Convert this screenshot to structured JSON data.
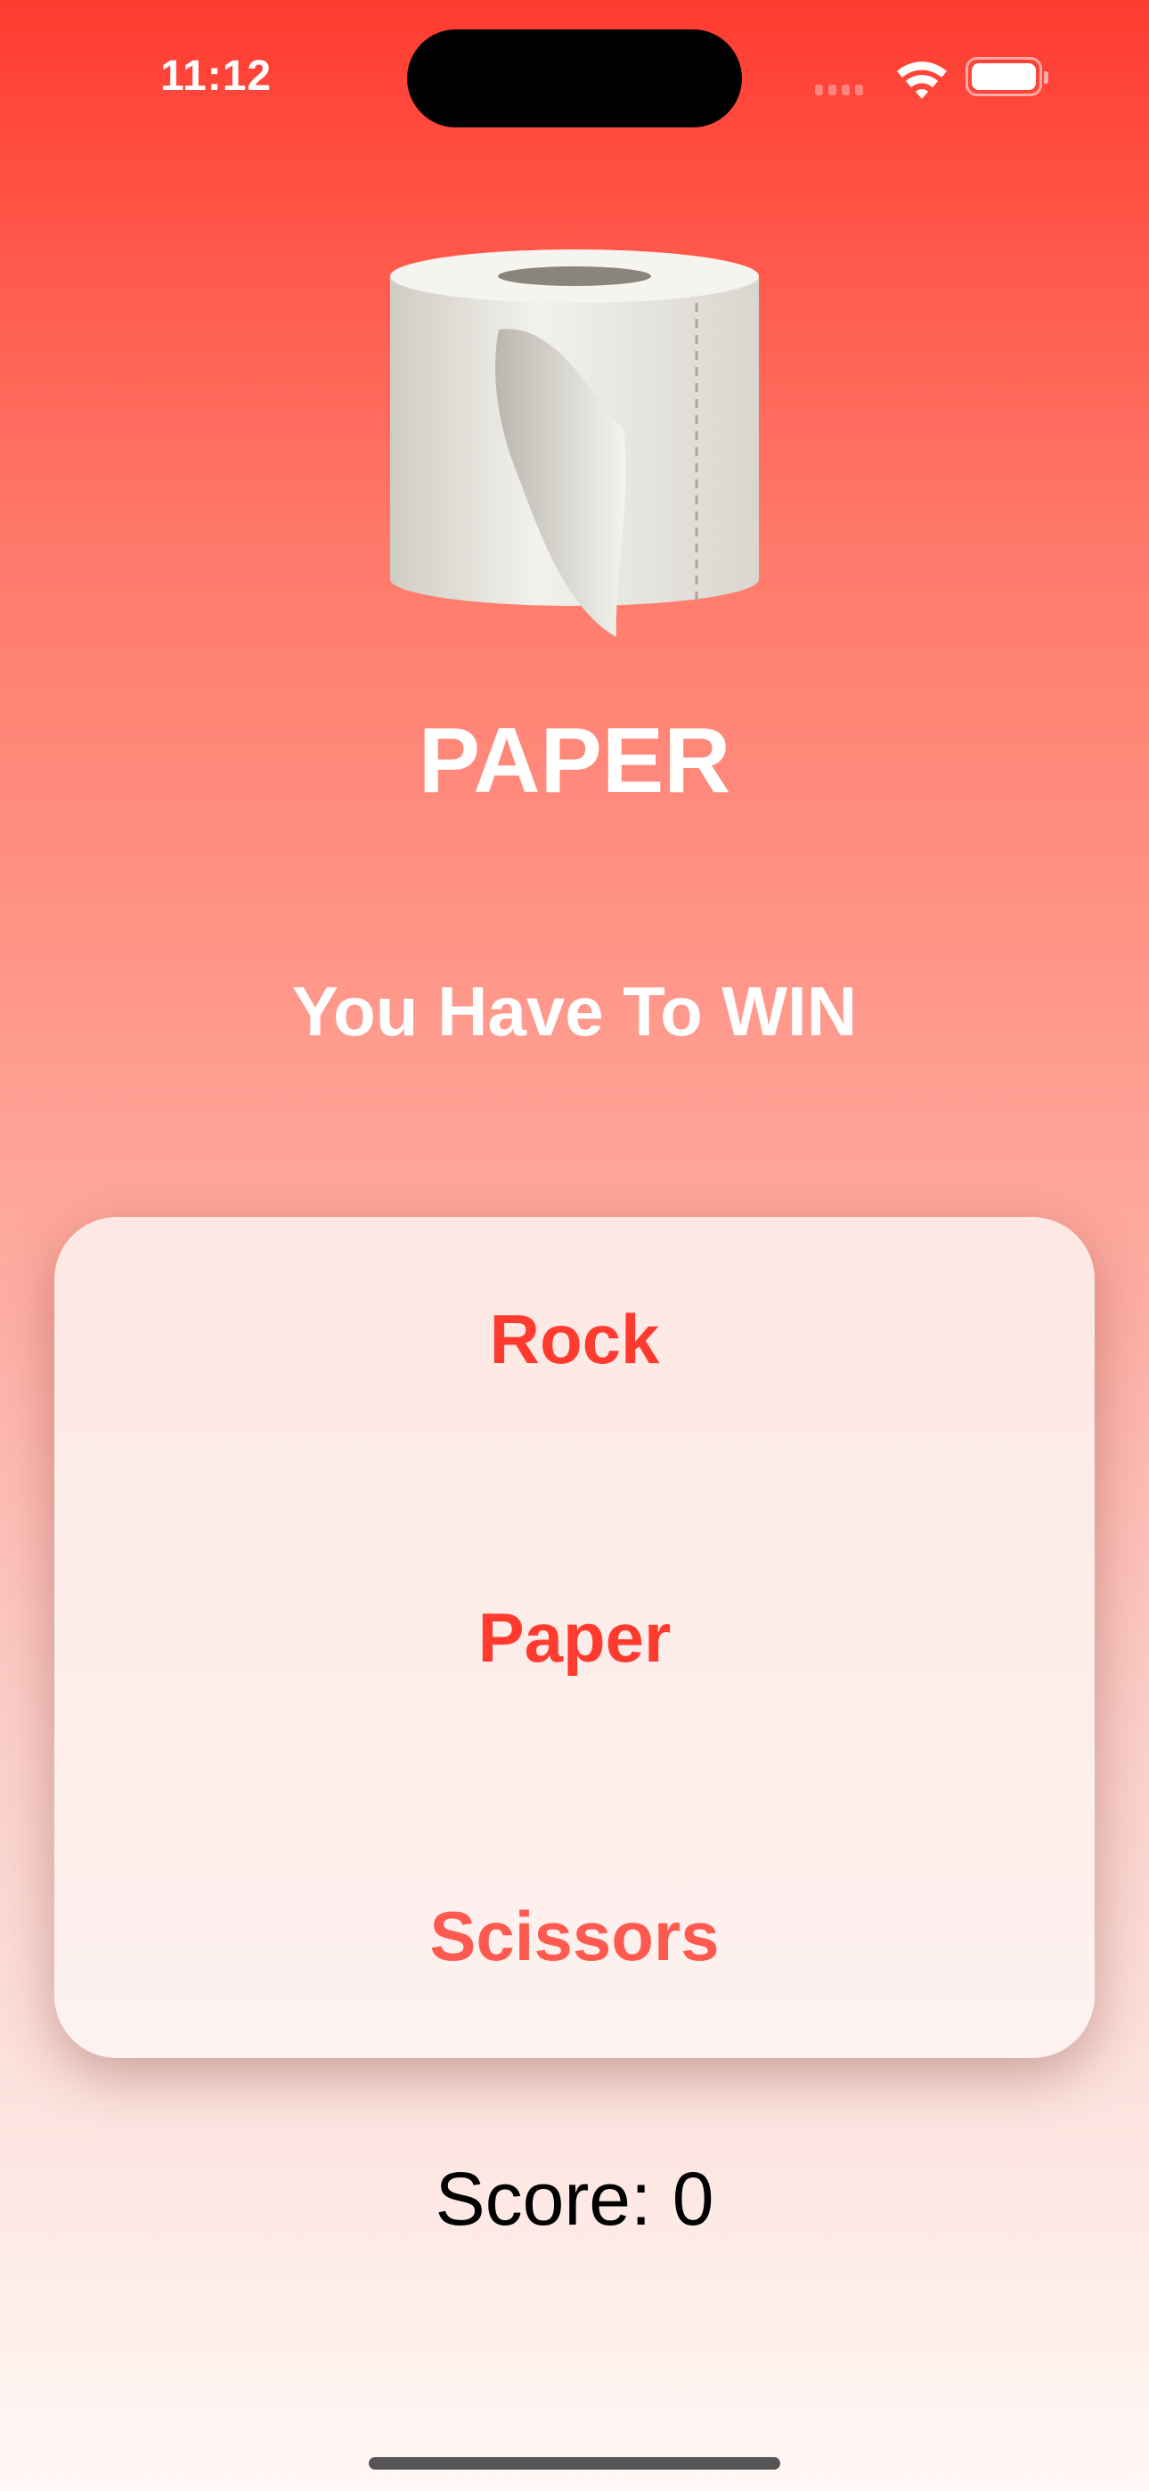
{
  "status_bar": {
    "time": "11:12",
    "icons": [
      "signal-icon",
      "wifi-icon",
      "battery-icon"
    ]
  },
  "game": {
    "computer_choice": "PAPER",
    "computer_choice_icon": "toilet-paper-roll-emoji",
    "instruction": "You Have To WIN",
    "options": [
      {
        "label": "Rock"
      },
      {
        "label": "Paper"
      },
      {
        "label": "Scissors"
      }
    ],
    "score_text": "Score: 0"
  },
  "colors": {
    "accent": "#ff3b30",
    "background_top": "#ff3b30",
    "background_bottom": "#fff8f5"
  }
}
